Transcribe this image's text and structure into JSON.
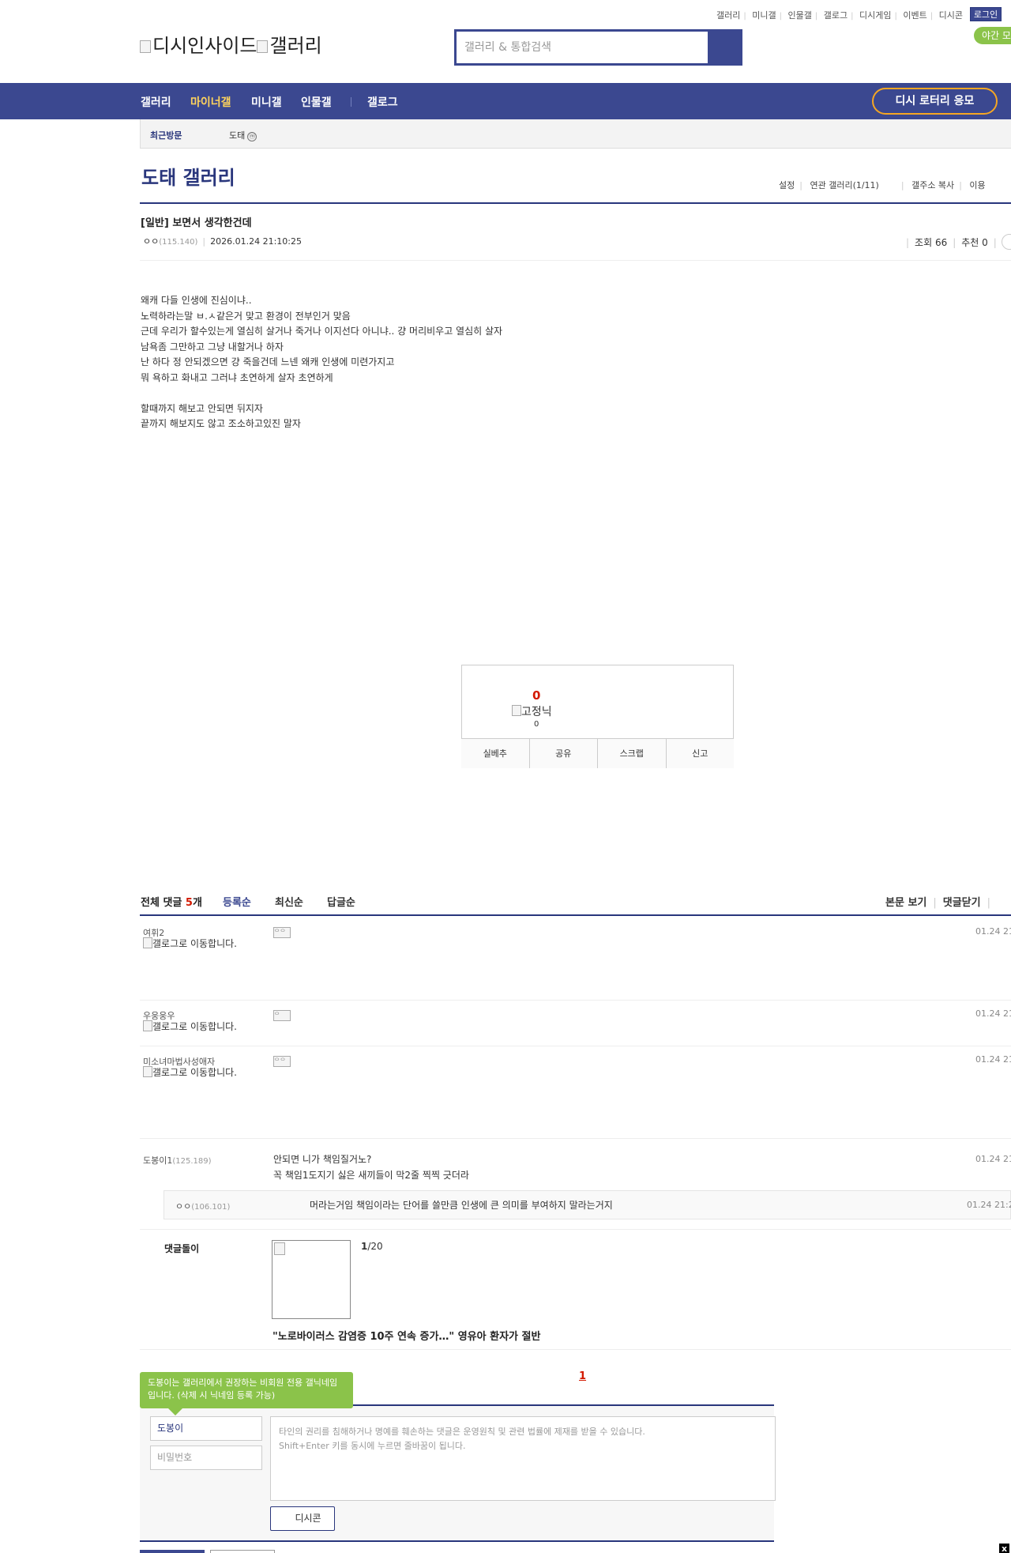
{
  "top_util": {
    "links": [
      "갤러리",
      "미니갤",
      "인물갤",
      "갤로그",
      "디시게임",
      "이벤트",
      "디시콘"
    ],
    "login": "로그인",
    "night": "야간 모"
  },
  "logo": {
    "alt1": "디시인사이드",
    "alt2": "갤러리"
  },
  "search": {
    "placeholder": "갤러리 & 통합검색"
  },
  "nav": {
    "items": [
      "갤러리",
      "마이너갤",
      "미니갤",
      "인물갤",
      "갤로그"
    ],
    "lottery": "디시 로터리 응모"
  },
  "recent": {
    "label": "최근방문",
    "item": "도태",
    "badge": "ⓜ"
  },
  "gallery": {
    "title": "도태 갤러리",
    "links": [
      "설정",
      "연관 갤러리(1/11)",
      "갤주소 복사",
      "이용"
    ]
  },
  "post": {
    "title": "[일반] 보면서 생각한건데",
    "writer": "ㅇㅇ",
    "ip": "(115.140)",
    "date": "2026.01.24 21:10:25",
    "views": "조회 66",
    "recommend": "추천 0",
    "body": [
      "왜캐 다들 인생에 진심이냐..",
      "노력하라는말 ㅂ.ㅅ같은거 맞고 환경이 전부인거 맞음",
      "근데 우리가 할수있는게 열심히 살거나 죽거나 이지선다 아니냐.. 걍 머리비우고 열심히 살자",
      "남욕좀 그만하고 그냥 내할거나 하자",
      "난 하다 정 안되겠으면 걍 죽을건데 느넨 왜캐 인생에 미련가지고",
      "뭐 욕하고 화내고 그러냐 초연하게 살자 초연하게",
      "",
      "할때까지 해보고 안되면 뒤지자",
      "끝까지 해보지도 않고 조소하고있진 말자"
    ]
  },
  "recommend_box": {
    "count": "0",
    "img_alt": "고정닉",
    "sub_count": "0",
    "buttons": [
      "실베추",
      "공유",
      "스크랩",
      "신고"
    ]
  },
  "comments_head": {
    "label": "전체 댓글",
    "count": "5",
    "unit": "개",
    "sort": [
      "등록순",
      "최신순",
      "답글순"
    ],
    "right": [
      "본문 보기",
      "댓글닫기"
    ]
  },
  "comments": [
    {
      "nick": "여휘2",
      "gallog": "갤로그로 이동합니다.",
      "dccon": "ᄋᄋ",
      "date": "01.24 21"
    },
    {
      "nick": "우웅웅우",
      "gallog": "갤로그로 이동합니다.",
      "dccon": "ᄋ",
      "date": "01.24 21"
    },
    {
      "nick": "미소녀마법사성애자",
      "gallog": "갤로그로 이동합니다.",
      "dccon": "ᄋᄋ",
      "date": "01.24 21"
    },
    {
      "nick": "도봉이1",
      "ip": "(125.189)",
      "lines": [
        "안되면 니가 책임질거노?",
        "꼭 책임1도지기 싫은 새끼들이 막2줄 찍찍 긋더라"
      ],
      "date": "01.24 21"
    }
  ],
  "reply": {
    "nick": "ㅇㅇ",
    "ip": "(106.101)",
    "text": "머라는거임 책임이라는 단어를 쓸만큼 인생에 큰 의미를 부여하지 말라는거지",
    "date": "01.24 21:2"
  },
  "news": {
    "label": "댓글돌이",
    "page_current": "1",
    "page_total": "/20",
    "title": "\"노로바이러스 감염증 10주 연속 증가…\" 영유아 환자가 절반"
  },
  "pagination": {
    "current": "1"
  },
  "write": {
    "tooltip": "도봉이는 갤러리에서 권장하는 비회원 전용 갤닉네임입니다. (삭제 시 닉네임 등록 가능)",
    "nick_value": "도봉이",
    "password_placeholder": "비밀번호",
    "textarea_line1": "타인의 권리를 침해하거나 명예를 훼손하는 댓글은 운영원칙 및 관련 법률에 제재를 받을 수 있습니다.",
    "textarea_line2": "Shift+Enter 키를 동시에 누르면 줄바꿈이 됩니다.",
    "dccon_btn": "디시콘"
  },
  "close": "x"
}
